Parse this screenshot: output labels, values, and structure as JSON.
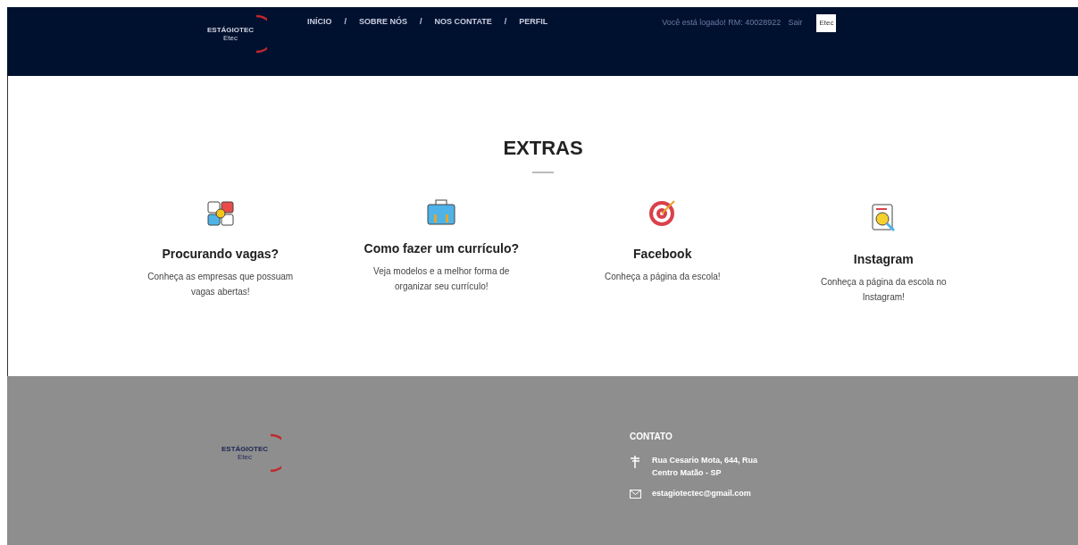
{
  "header": {
    "logo": {
      "name": "ESTÁGIOTEC",
      "sub": "Etec"
    },
    "nav": [
      {
        "label": "INÍCIO"
      },
      {
        "label": "SOBRE NÓS"
      },
      {
        "label": "NOS CONTATE"
      },
      {
        "label": "PERFIL"
      }
    ],
    "separator": "/",
    "logged_in": "Você está logado! RM: 40028922",
    "logout": "Sair",
    "badge": "Etec"
  },
  "section": {
    "title": "EXTRAS",
    "cards": [
      {
        "kind": "money",
        "title": "Procurando vagas?",
        "text": "Conheça as empresas que possuam vagas abertas!"
      },
      {
        "kind": "briefcase",
        "title": "Como fazer um currículo?",
        "text": "Veja modelos e a melhor forma de organizar seu currículo!"
      },
      {
        "kind": "target",
        "title": "Facebook",
        "text": "Conheça a página da escola!"
      },
      {
        "kind": "search",
        "title": "Instagram",
        "text": "Conheça a página da escola no Instagram!"
      }
    ]
  },
  "footer": {
    "logo": {
      "name": "ESTÁGIOTEC",
      "sub": "Etec"
    },
    "heading": "CONTATO",
    "address": "Rua Cesario Mota, 644, Rua Centro Matão - SP",
    "email": "estagiotectec@gmail.com"
  }
}
